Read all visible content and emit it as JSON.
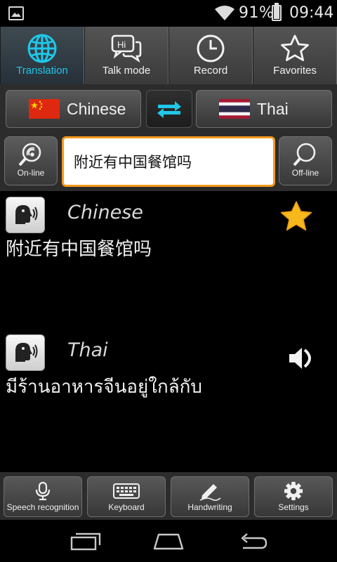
{
  "status_bar": {
    "battery_percent": "91%",
    "battery_level": 0.91,
    "time": "09:44",
    "icons": [
      "gallery-icon",
      "wifi-icon",
      "battery-icon"
    ]
  },
  "tabs": [
    {
      "label": "Translation",
      "icon": "globe-icon",
      "active": true
    },
    {
      "label": "Talk mode",
      "icon": "chat-bubbles-icon",
      "active": false
    },
    {
      "label": "Record",
      "icon": "clock-icon",
      "active": false
    },
    {
      "label": "Favorites",
      "icon": "star-outline-icon",
      "active": false
    }
  ],
  "languages": {
    "source": {
      "label": "Chinese",
      "flag": "china-flag-icon"
    },
    "target": {
      "label": "Thai",
      "flag": "thailand-flag-icon"
    },
    "swap_icon": "swap-arrows-icon"
  },
  "search": {
    "online_label": "On-line",
    "offline_label": "Off-line",
    "query": "附近有中国餐馆吗"
  },
  "results": {
    "source": {
      "language": "Chinese",
      "text": "附近有中国餐馆吗"
    },
    "target": {
      "language": "Thai",
      "text": "มีร้านอาหารจีนอยู่ใกล้กับ"
    }
  },
  "toolbar": [
    {
      "label": "Speech recognition",
      "icon": "microphone-icon"
    },
    {
      "label": "Keyboard",
      "icon": "keyboard-icon"
    },
    {
      "label": "Handwriting",
      "icon": "pen-icon"
    },
    {
      "label": "Settings",
      "icon": "gear-icon"
    }
  ],
  "colors": {
    "accent": "#20c7e8",
    "input_border": "#f39a1d",
    "star": "#f6b81c",
    "background": "#000000"
  }
}
